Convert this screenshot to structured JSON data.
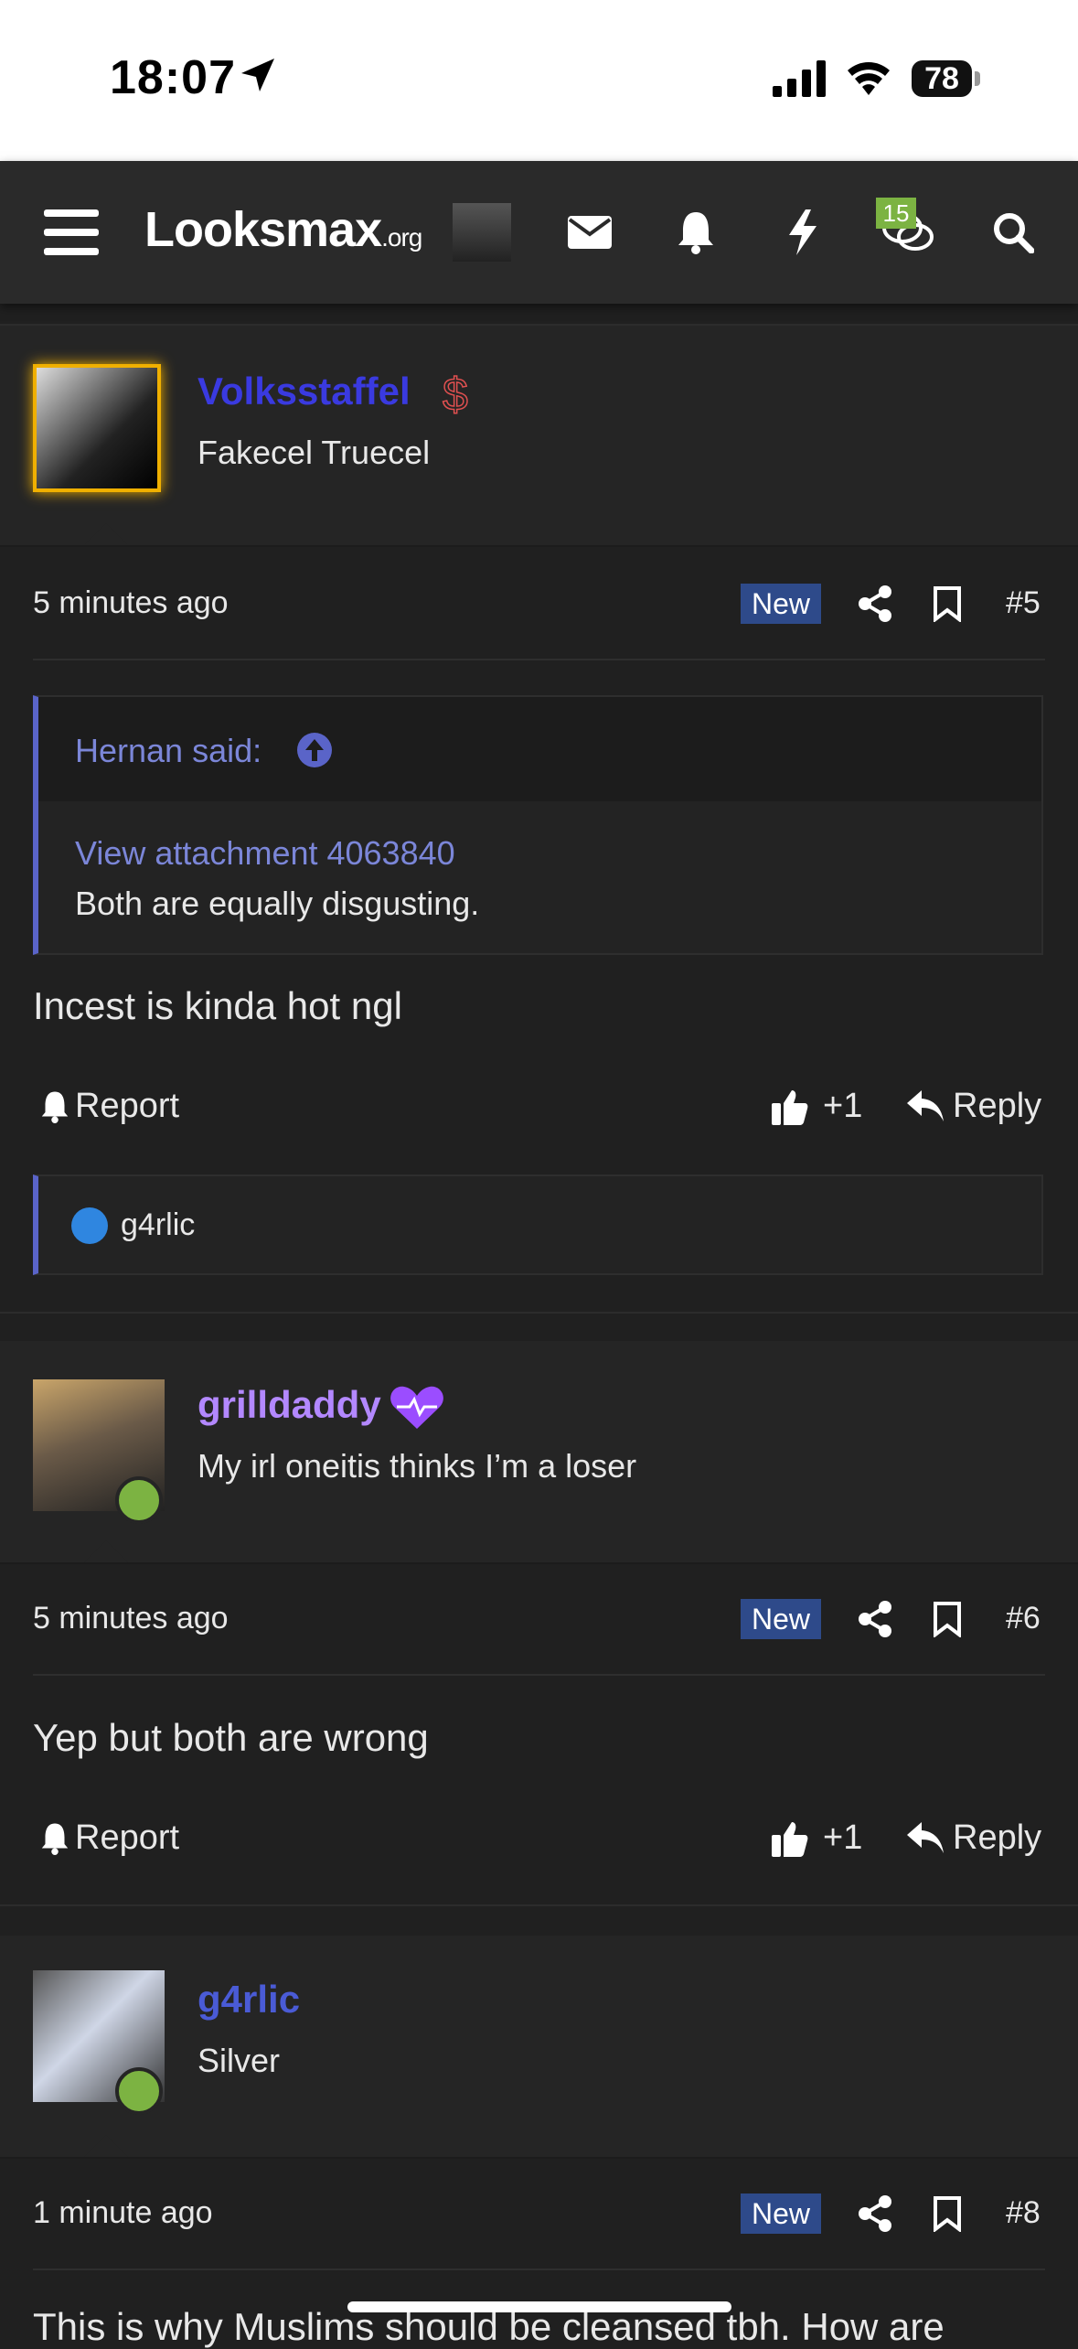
{
  "status_bar": {
    "time": "18:07",
    "battery": "78"
  },
  "nav": {
    "logo_text": "Looksmax",
    "logo_suffix": ".org",
    "conversations_badge": "15"
  },
  "posts": [
    {
      "username": "Volksstaffel",
      "user_title": "Fakecel Truecel",
      "time": "5 minutes ago",
      "new_label": "New",
      "post_number": "#5",
      "quote": {
        "author": "Hernan said:",
        "attachment": "View attachment 4063840",
        "text": "Both are equally disgusting."
      },
      "body": "Incest is kinda hot ngl",
      "report_label": "Report",
      "like_label": "+1",
      "reply_label": "Reply",
      "reaction_user": "g4rlic"
    },
    {
      "username": "grilldaddy",
      "user_title": "My irl oneitis thinks I’m a loser",
      "time": "5 minutes ago",
      "new_label": "New",
      "post_number": "#6",
      "body": "Yep but both are wrong",
      "report_label": "Report",
      "like_label": "+1",
      "reply_label": "Reply"
    },
    {
      "username": "g4rlic",
      "user_title": "Silver",
      "time": "1 minute ago",
      "new_label": "New",
      "post_number": "#8",
      "body": "This is why Muslims should be cleansed tbh. How are"
    }
  ],
  "colors": {
    "accent": "#5a64c8",
    "online": "#7cb342",
    "new_badge": "#2e4a8a",
    "username_1": "#3a3ae0",
    "username_2": "#b388ff",
    "username_3": "#4a5bd6"
  }
}
